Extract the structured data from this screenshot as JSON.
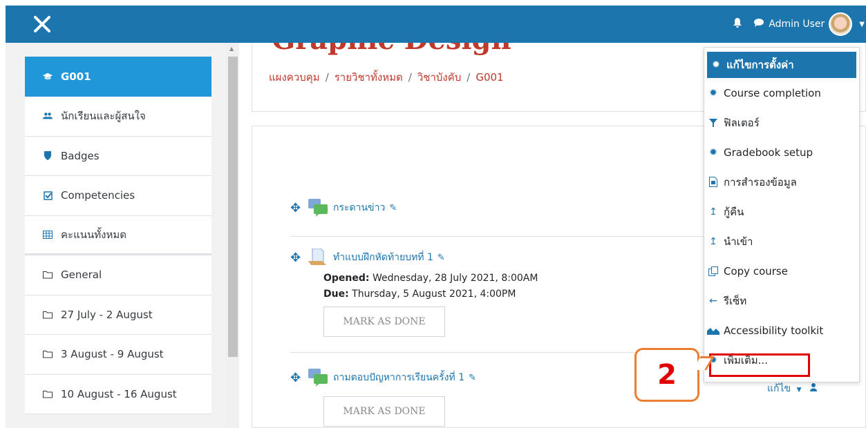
{
  "topbar": {
    "user_name": "Admin User",
    "bell_icon": "bell-icon",
    "chat_icon": "chat-icon",
    "close_icon": "close-icon",
    "color": "#1c75ad"
  },
  "sidebar": {
    "items": [
      {
        "label": "G001",
        "icon": "graduation-cap-icon",
        "active": true
      },
      {
        "label": "นักเรียนและผู้สนใจ",
        "icon": "users-icon"
      },
      {
        "label": "Badges",
        "icon": "shield-icon"
      },
      {
        "label": "Competencies",
        "icon": "checkbox-icon"
      },
      {
        "label": "คะแนนทั้งหมด",
        "icon": "table-icon"
      },
      {
        "label": "General",
        "icon": "folder-icon"
      },
      {
        "label": "27 July - 2 August",
        "icon": "folder-icon"
      },
      {
        "label": "3 August - 9 August",
        "icon": "folder-icon"
      },
      {
        "label": "10 August - 16 August",
        "icon": "folder-icon"
      }
    ]
  },
  "header": {
    "course_title": "Graphic Design",
    "breadcrumb": [
      "แผงควบคุม",
      "รายวิชาทั้งหมด",
      "วิชาบังคับ",
      "G001"
    ]
  },
  "activities": [
    {
      "title": "กระดานข่าว",
      "icon": "forum-icon"
    },
    {
      "title": "ทำแบบฝึกหัดท้ายบทที่ 1",
      "icon": "assignment-icon",
      "opened_label": "Opened:",
      "opened_value": " Wednesday, 28 July 2021, 8:00AM",
      "due_label": "Due:",
      "due_value": " Thursday, 5 August 2021, 4:00PM",
      "button": "MARK AS DONE"
    },
    {
      "title": "ถามตอบปัญหาการเรียนครั้งที่ 1",
      "icon": "forum-icon",
      "button": "MARK AS DONE",
      "edit_label": "แก้ไข"
    }
  ],
  "dropdown": {
    "items": [
      {
        "label": "แก้ไขการตั้งค่า",
        "icon": "gear-icon",
        "active": true
      },
      {
        "label": "Course completion",
        "icon": "gear-icon"
      },
      {
        "label": "ฟิลเตอร์",
        "icon": "filter-icon"
      },
      {
        "label": "Gradebook setup",
        "icon": "gear-icon"
      },
      {
        "label": "การสำรองข้อมูล",
        "icon": "file-icon"
      },
      {
        "label": "กู้คืน",
        "icon": "upload-icon"
      },
      {
        "label": "นำเข้า",
        "icon": "upload-icon"
      },
      {
        "label": "Copy course",
        "icon": "copy-icon"
      },
      {
        "label": "รีเซ็ท",
        "icon": "arrow-left-icon"
      },
      {
        "label": "Accessibility toolkit",
        "icon": "chart-icon"
      },
      {
        "label": "เพิ่มเติม...",
        "icon": "gear-icon"
      }
    ]
  },
  "annotation": {
    "number": "2",
    "box_color": "#e00000",
    "callout_color": "#ed7d31"
  }
}
